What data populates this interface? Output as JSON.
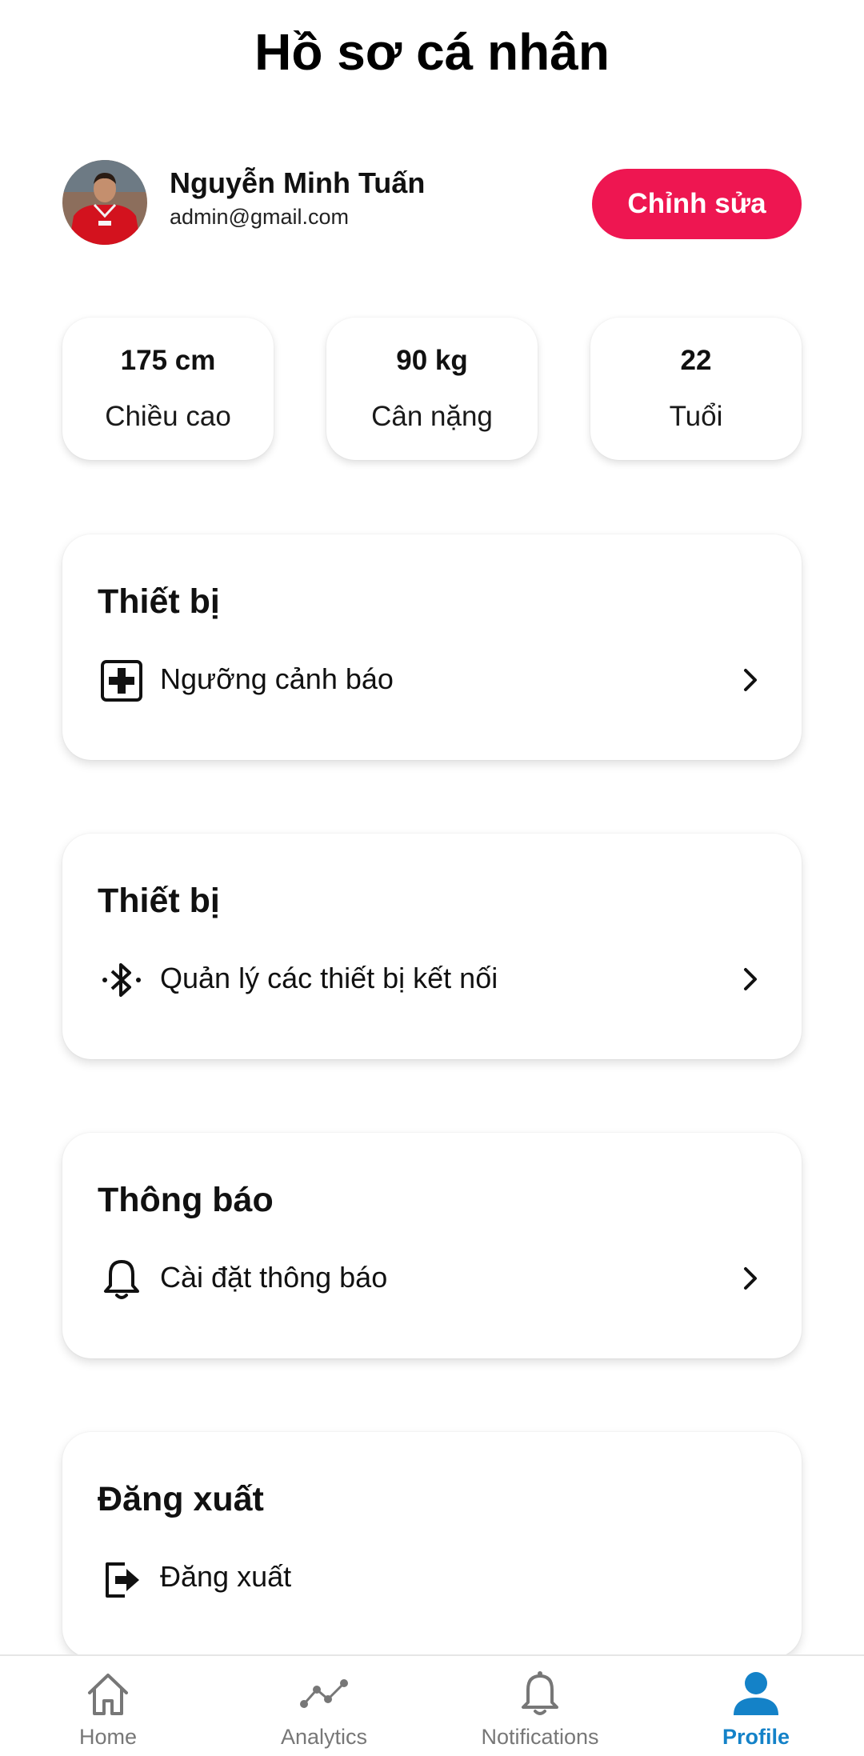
{
  "header": {
    "title": "Hồ sơ cá nhân"
  },
  "profile": {
    "name": "Nguyễn Minh Tuấn",
    "email": "admin@gmail.com",
    "edit_label": "Chỉnh sửa"
  },
  "stats": [
    {
      "value": "175 cm",
      "label": "Chiều cao"
    },
    {
      "value": "90 kg",
      "label": "Cân nặng"
    },
    {
      "value": "22",
      "label": "Tuổi"
    }
  ],
  "sections": [
    {
      "title": "Thiết bị",
      "item": {
        "label": "Ngưỡng cảnh báo",
        "icon": "medical-plus-icon"
      }
    },
    {
      "title": "Thiết bị",
      "item": {
        "label": "Quản lý các thiết bị kết nối",
        "icon": "bluetooth-icon"
      }
    },
    {
      "title": "Thông báo",
      "item": {
        "label": "Cài đặt thông báo",
        "icon": "bell-icon"
      }
    },
    {
      "title": "Đăng xuất",
      "item": {
        "label": "Đăng xuất",
        "icon": "logout-icon"
      }
    }
  ],
  "bottom_nav": [
    {
      "label": "Home",
      "icon": "home-icon"
    },
    {
      "label": "Analytics",
      "icon": "analytics-icon"
    },
    {
      "label": "Notifications",
      "icon": "bell-icon"
    },
    {
      "label": "Profile",
      "icon": "person-icon"
    }
  ],
  "colors": {
    "accent": "#ee1651",
    "nav_active": "#1482c8",
    "nav_inactive": "#777777"
  }
}
